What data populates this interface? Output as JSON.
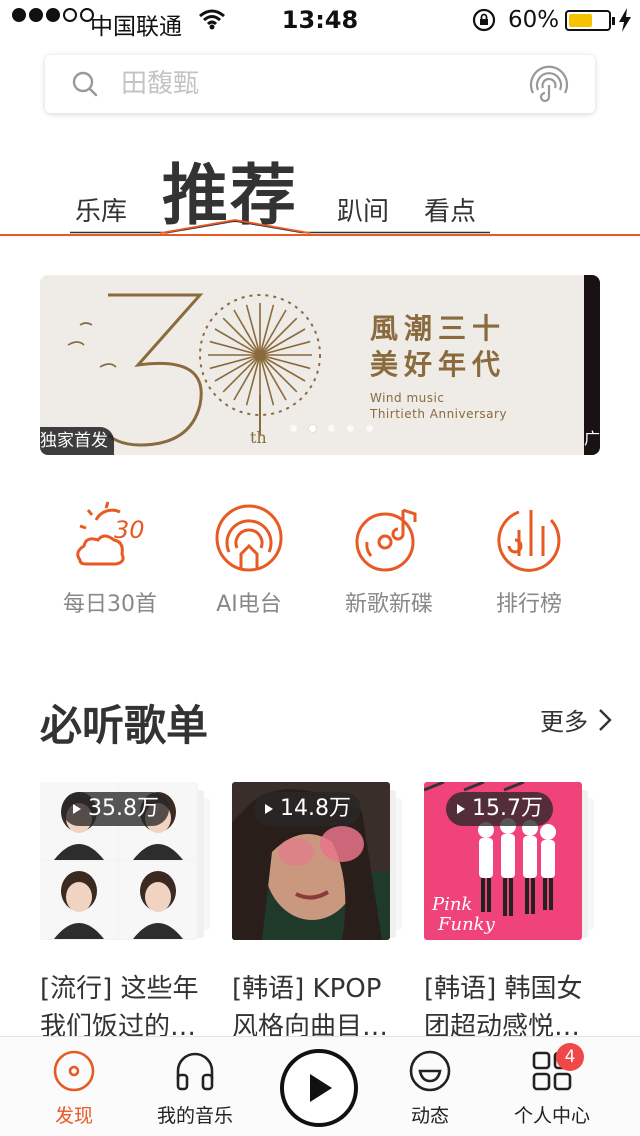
{
  "status_bar": {
    "carrier": "中国联通",
    "time": "13:48",
    "battery": "60%",
    "battery_level": 0.6
  },
  "search": {
    "placeholder": "田馥甄"
  },
  "tabs": [
    {
      "label": "乐库",
      "active": false
    },
    {
      "label": "推荐",
      "active": true
    },
    {
      "label": "趴间",
      "active": false
    },
    {
      "label": "看点",
      "active": false
    }
  ],
  "banner": {
    "title_line1": "風潮三十",
    "title_line2": "美好年代",
    "subtitle_line1": "Wind music",
    "subtitle_line2": "Thirtieth Anniversary",
    "badge": "独家首发",
    "side_text": "广",
    "dot_count": 5,
    "active_dot": 1
  },
  "quick_entries": [
    {
      "label": "每日30首",
      "icon": "daily-30-icon"
    },
    {
      "label": "AI电台",
      "icon": "ai-radio-icon"
    },
    {
      "label": "新歌新碟",
      "icon": "new-album-icon"
    },
    {
      "label": "排行榜",
      "icon": "chart-ranking-icon"
    }
  ],
  "section": {
    "title": "必听歌单",
    "more": "更多"
  },
  "playlists": [
    {
      "count": "35.8万",
      "title_line1": "[流行] 这些年",
      "title_line2": "我们饭过的…"
    },
    {
      "count": "14.8万",
      "title_line1": "[韩语] KPOP",
      "title_line2": "风格向曲目…"
    },
    {
      "count": "15.7万",
      "title_line1": "[韩语] 韩国女",
      "title_line2": "团超动感悦…"
    }
  ],
  "tabbar": {
    "items": [
      {
        "label": "发现",
        "active": true
      },
      {
        "label": "我的音乐",
        "active": false
      },
      {
        "label": "动态",
        "active": false
      },
      {
        "label": "个人中心",
        "active": false
      }
    ],
    "badge": "4"
  },
  "colors": {
    "accent": "#e85a23",
    "banner_gold": "#8a6b3d",
    "badge_red": "#f04848",
    "pink_cover": "#f0437a"
  }
}
